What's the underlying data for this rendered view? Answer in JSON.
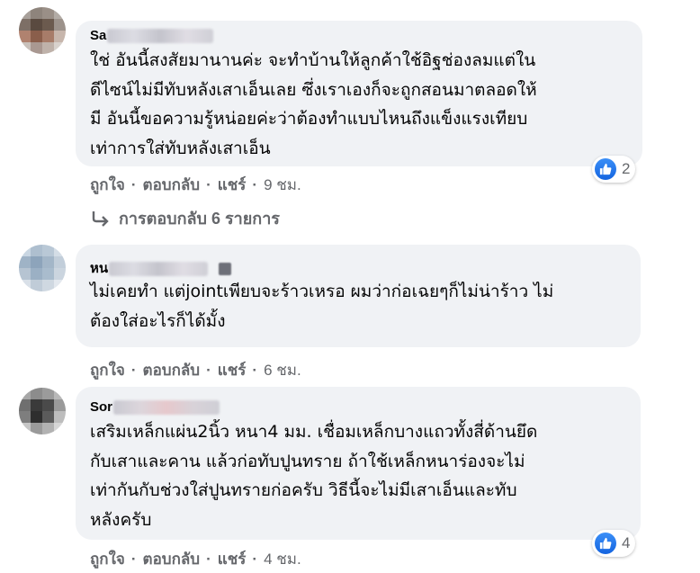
{
  "comments": [
    {
      "author_visible": "Sa",
      "text": "ใช่ อันนี้สงสัยมานานค่ะ จะทำบ้านให้ลูกค้าใช้อิฐช่องลมแต่ใน\nดีไซน์ไม่มีทับหลังเสาเอ็นเลย ซึ่งเราเองก็จะถูกสอนมาตลอดให้\nมี อันนี้ขอความรู้หน่อยค่ะว่าต้องทำแบบไหนถึงแข็งแรงเทียบ\nเท่าการใส่ทับหลังเสาเอ็น",
      "like_label": "ถูกใจ",
      "reply_label": "ตอบกลับ",
      "share_label": "แชร์",
      "time": "9 ชม.",
      "reaction_count": "2"
    },
    {
      "author_visible": "หน",
      "text": "ไม่เคยทำ แต่jointเพียบจะร้าวเหรอ ผมว่าก่อเฉยๆก็ไม่น่าร้าว ไม่\nต้องใส่อะไรก็ได้มั้ง",
      "like_label": "ถูกใจ",
      "reply_label": "ตอบกลับ",
      "share_label": "แชร์",
      "time": "6 ชม."
    },
    {
      "author_visible": "Sor",
      "text": "เสริมเหล็กแผ่น2นิ้ว หนา4 มม. เชื่อมเหล็กบางแถวทั้งสี่ด้านยึด\nกับเสาและคาน แล้วก่อทับปูนทราย ถ้าใช้เหล็กหนาร่องจะไม่\nเท่ากันกับช่วงใส่ปูนทรายก่อครับ วิธีนี้จะไม่มีเสาเอ็นและทับ\nหลังครับ",
      "like_label": "ถูกใจ",
      "reply_label": "ตอบกลับ",
      "share_label": "แชร์",
      "time": "4 ชม.",
      "reaction_count": "4"
    }
  ],
  "replies_link": "การตอบกลับ 6 รายการ",
  "separator": "·",
  "icons": {
    "reaction": "like-icon",
    "reply_arrow": "reply-arrow-icon"
  },
  "colors": {
    "bubble": "#f0f2f5",
    "meta": "#65676b",
    "like_blue": "#1877f2"
  }
}
